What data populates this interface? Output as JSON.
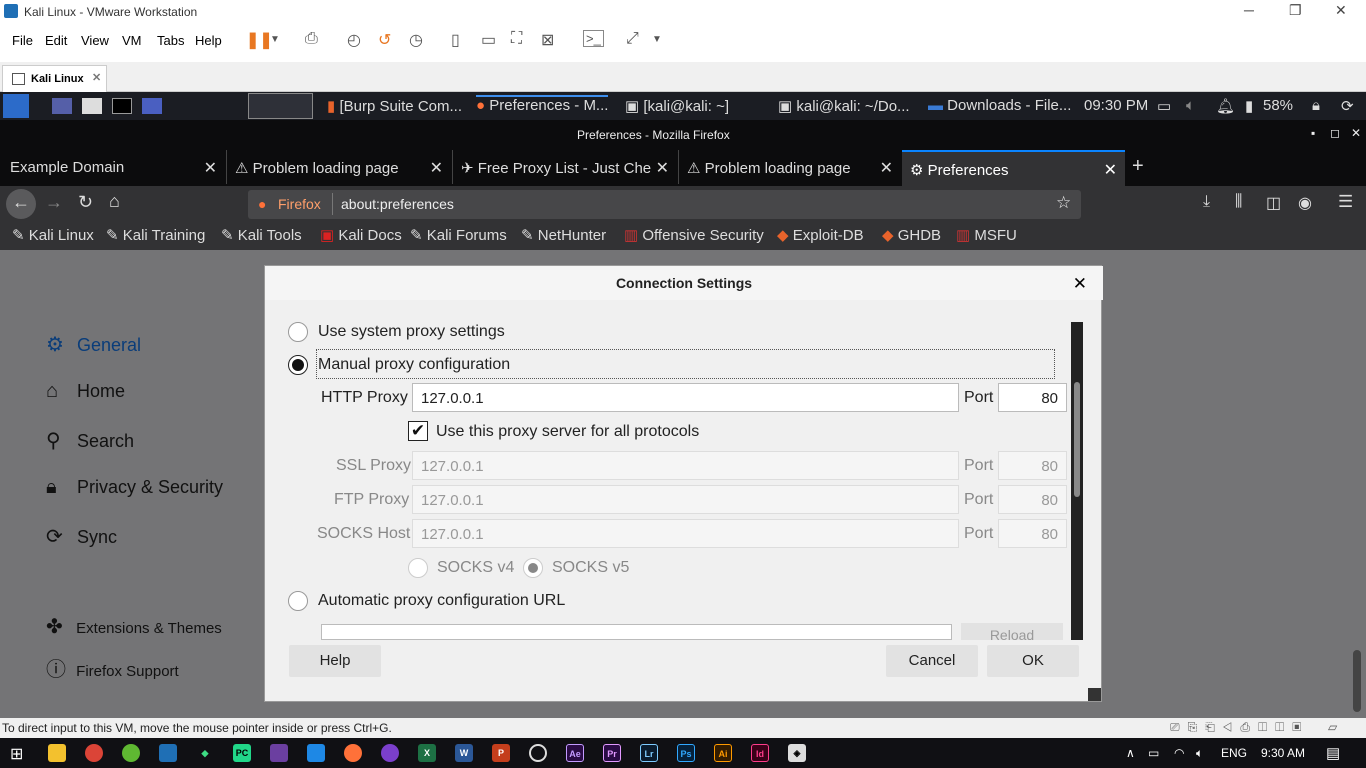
{
  "vmware": {
    "title": "Kali Linux - VMware Workstation",
    "menu": [
      "File",
      "Edit",
      "View",
      "VM",
      "Tabs",
      "Help"
    ],
    "tab": "Kali Linux",
    "status": "To direct input to this VM, move the mouse pointer inside or press Ctrl+G."
  },
  "kali_panel": {
    "tasks": [
      "[Burp Suite Com...",
      "Preferences - M...",
      "[kali@kali: ~]",
      "kali@kali: ~/Do...",
      "Downloads - File..."
    ],
    "time": "09:30 PM",
    "battery": "58%"
  },
  "firefox": {
    "window_title": "Preferences - Mozilla Firefox",
    "tabs": [
      "Example Domain",
      "Problem loading page",
      "Free Proxy List - Just Che",
      "Problem loading page",
      "Preferences"
    ],
    "url_identity": "Firefox",
    "url": "about:preferences",
    "bookmarks": [
      "Kali Linux",
      "Kali Training",
      "Kali Tools",
      "Kali Docs",
      "Kali Forums",
      "NetHunter",
      "Offensive Security",
      "Exploit-DB",
      "GHDB",
      "MSFU"
    ]
  },
  "sidebar": {
    "items": [
      "General",
      "Home",
      "Search",
      "Privacy & Security",
      "Sync"
    ],
    "footer": [
      "Extensions & Themes",
      "Firefox Support"
    ]
  },
  "dialog": {
    "title": "Connection Settings",
    "opt_system": "Use system proxy settings",
    "opt_manual": "Manual proxy configuration",
    "http_label": "HTTP Proxy",
    "http_value": "127.0.0.1",
    "port_label": "Port",
    "http_port": "80",
    "all_protocols": "Use this proxy server for all protocols",
    "ssl_label": "SSL Proxy",
    "ssl_value": "127.0.0.1",
    "ssl_port": "80",
    "ftp_label": "FTP Proxy",
    "ftp_value": "127.0.0.1",
    "ftp_port": "80",
    "socks_label": "SOCKS Host",
    "socks_value": "127.0.0.1",
    "socks_port": "80",
    "socks_v4": "SOCKS v4",
    "socks_v5": "SOCKS v5",
    "opt_auto": "Automatic proxy configuration URL",
    "reload": "Reload",
    "help": "Help",
    "cancel": "Cancel",
    "ok": "OK"
  },
  "taskbar": {
    "lang": "ENG",
    "time": "9:30 AM"
  }
}
